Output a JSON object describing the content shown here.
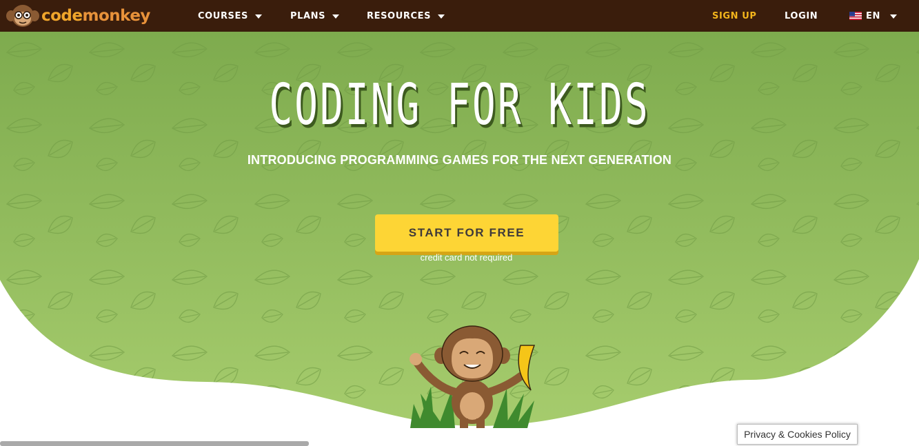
{
  "brand": {
    "logo_text_a": "code",
    "logo_text_b": "monkey"
  },
  "nav": {
    "courses": "COURSES",
    "plans": "PLANS",
    "resources": "RESOURCES",
    "signup": "SIGN UP",
    "login": "LOGIN",
    "language": "EN"
  },
  "hero": {
    "title": "CODING FOR KIDS",
    "subtitle": "INTRODUCING PROGRAMMING GAMES FOR THE NEXT GENERATION",
    "cta_label": "START FOR FREE",
    "cta_note": "credit card not required"
  },
  "footer": {
    "privacy_label": "Privacy & Cookies Policy"
  },
  "colors": {
    "navbar": "#3a1d0c",
    "accent_yellow": "#fdd535",
    "signup": "#f3b51c",
    "hero_green_top": "#7eab4e",
    "hero_green_bottom": "#a6cc6d"
  },
  "icons": [
    "monkey-logo-icon",
    "caret-down-icon",
    "us-flag-icon",
    "monkey-mascot-illustration",
    "leaf-pattern"
  ]
}
